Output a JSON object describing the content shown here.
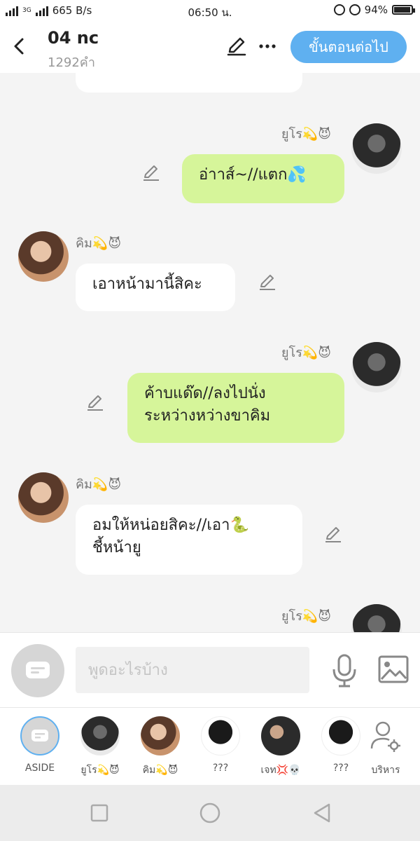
{
  "status": {
    "network_label": "3G",
    "speed": "665 B/s",
    "time": "06:50 น.",
    "battery": "94%",
    "battery_level": 0.94
  },
  "header": {
    "title": "04 nc",
    "subtitle": "1292คำ",
    "next_label": "ขั้นตอนต่อไป",
    "accent": "#5fb0f0"
  },
  "messages": [
    {
      "side": "in",
      "sender": "",
      "text": "",
      "lines": []
    },
    {
      "side": "out",
      "sender": "ยูโร💫😈",
      "lines": [
        "อ่าาส์~//แตก💦"
      ]
    },
    {
      "side": "in",
      "sender": "คิม💫😈",
      "lines": [
        "เอาหน้ามานี้สิคะ"
      ]
    },
    {
      "side": "out",
      "sender": "ยูโร💫😈",
      "lines": [
        "ค้าบแด๊ด//ลงไปนั่ง",
        "ระหว่างหว่างขาคิม"
      ]
    },
    {
      "side": "in",
      "sender": "คิม💫😈",
      "lines": [
        "อมให้หน่อยสิคะ//เอา🐍",
        "ชี้หน้ายู"
      ]
    },
    {
      "side": "out",
      "sender": "ยูโร💫😈",
      "lines": []
    }
  ],
  "input": {
    "placeholder": "พูดอะไรบ้าง"
  },
  "characters": [
    {
      "label": "ASIDE",
      "kind": "aside"
    },
    {
      "label": "ยูโร💫😈",
      "kind": "dark"
    },
    {
      "label": "คิม💫😈",
      "kind": "warm"
    },
    {
      "label": "???",
      "kind": "sil"
    },
    {
      "label": "เจท💢💀",
      "kind": "photo"
    },
    {
      "label": "???",
      "kind": "sil"
    },
    {
      "label": "บริหาร",
      "kind": "manage"
    }
  ],
  "colors": {
    "outgoing_bubble": "#d6f59a",
    "incoming_bubble": "#ffffff"
  }
}
